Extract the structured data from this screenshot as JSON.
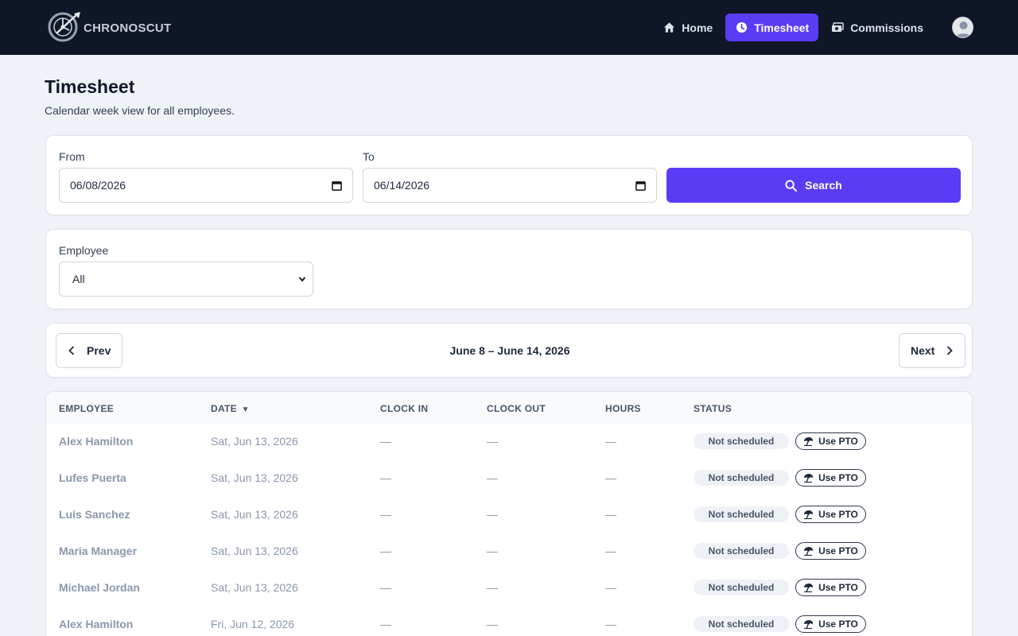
{
  "brand": {
    "name": "CHRONOSCUT"
  },
  "nav": [
    {
      "label": "Home",
      "icon": "home-icon",
      "active": false
    },
    {
      "label": "Timesheet",
      "icon": "clock-icon",
      "active": true
    },
    {
      "label": "Commissions",
      "icon": "cash-icon",
      "active": false
    }
  ],
  "page": {
    "title": "Timesheet",
    "subtitle": "Calendar week view for all employees."
  },
  "filters": {
    "from_label": "From",
    "from_value": "06/08/2026",
    "to_label": "To",
    "to_value": "06/14/2026",
    "search_label": "Search",
    "employee_label": "Employee",
    "employee_value": "All"
  },
  "pager": {
    "prev_label": "Prev",
    "next_label": "Next",
    "range": "June 8 – June 14, 2026"
  },
  "table": {
    "headers": {
      "employee": "EMPLOYEE",
      "date": "DATE",
      "clock_in": "CLOCK IN",
      "clock_out": "CLOCK OUT",
      "hours": "HOURS",
      "status": "STATUS"
    },
    "sort_indicator": "▼",
    "rows": [
      {
        "employee": "Alex Hamilton",
        "date": "Sat, Jun 13, 2026",
        "clock_in": "—",
        "clock_out": "—",
        "hours": "—",
        "status": "Not scheduled",
        "action": "Use PTO"
      },
      {
        "employee": "Lufes Puerta",
        "date": "Sat, Jun 13, 2026",
        "clock_in": "—",
        "clock_out": "—",
        "hours": "—",
        "status": "Not scheduled",
        "action": "Use PTO"
      },
      {
        "employee": "Luis Sanchez",
        "date": "Sat, Jun 13, 2026",
        "clock_in": "—",
        "clock_out": "—",
        "hours": "—",
        "status": "Not scheduled",
        "action": "Use PTO"
      },
      {
        "employee": "Maria Manager",
        "date": "Sat, Jun 13, 2026",
        "clock_in": "—",
        "clock_out": "—",
        "hours": "—",
        "status": "Not scheduled",
        "action": "Use PTO"
      },
      {
        "employee": "Michael Jordan",
        "date": "Sat, Jun 13, 2026",
        "clock_in": "—",
        "clock_out": "—",
        "hours": "—",
        "status": "Not scheduled",
        "action": "Use PTO"
      },
      {
        "employee": "Alex Hamilton",
        "date": "Fri, Jun 12, 2026",
        "clock_in": "—",
        "clock_out": "—",
        "hours": "—",
        "status": "Not scheduled",
        "action": "Use PTO"
      }
    ]
  },
  "colors": {
    "accent": "#5b3cf5",
    "topbar": "#0e1628",
    "background": "#eff2f7"
  }
}
